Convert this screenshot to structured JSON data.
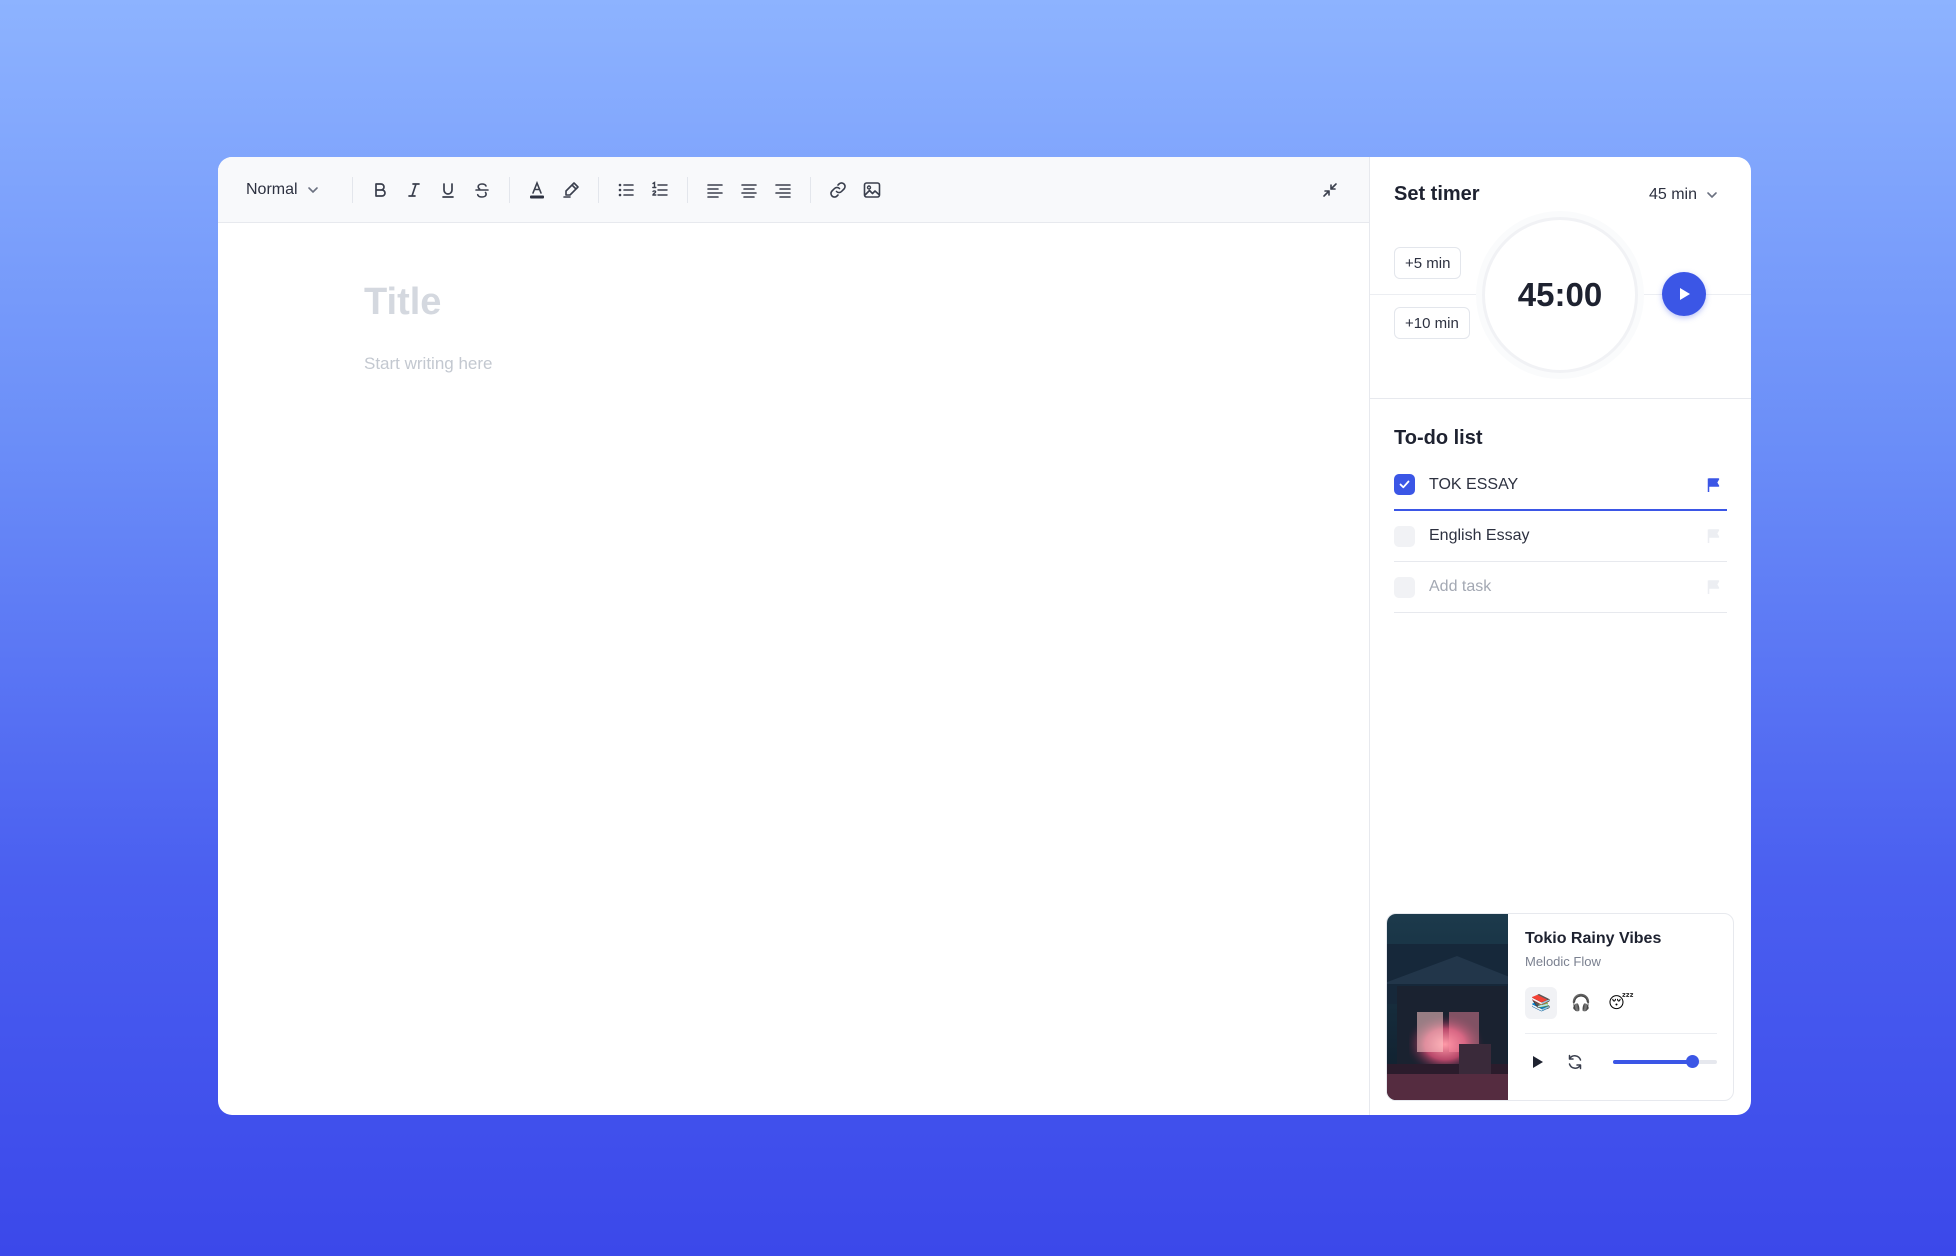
{
  "toolbar": {
    "style_select": "Normal"
  },
  "editor": {
    "title_placeholder": "Title",
    "body_placeholder": "Start writing here"
  },
  "timer": {
    "title": "Set timer",
    "duration_select": "45 min",
    "add_5": "+5 min",
    "add_10": "+10 min",
    "display": "45:00"
  },
  "todo": {
    "title": "To-do list",
    "items": [
      {
        "label": "TOK ESSAY",
        "checked": true,
        "flagged": true
      },
      {
        "label": "English Essay",
        "checked": false,
        "flagged": false
      }
    ],
    "add_placeholder": "Add task"
  },
  "music": {
    "track_title": "Tokio Rainy Vibes",
    "artist": "Melodic Flow",
    "moods": [
      "📚",
      "🎧",
      "😴"
    ],
    "volume": 0.76
  },
  "colors": {
    "accent": "#3b56e6",
    "text": "#1e2230",
    "muted": "#a3a8b3"
  }
}
